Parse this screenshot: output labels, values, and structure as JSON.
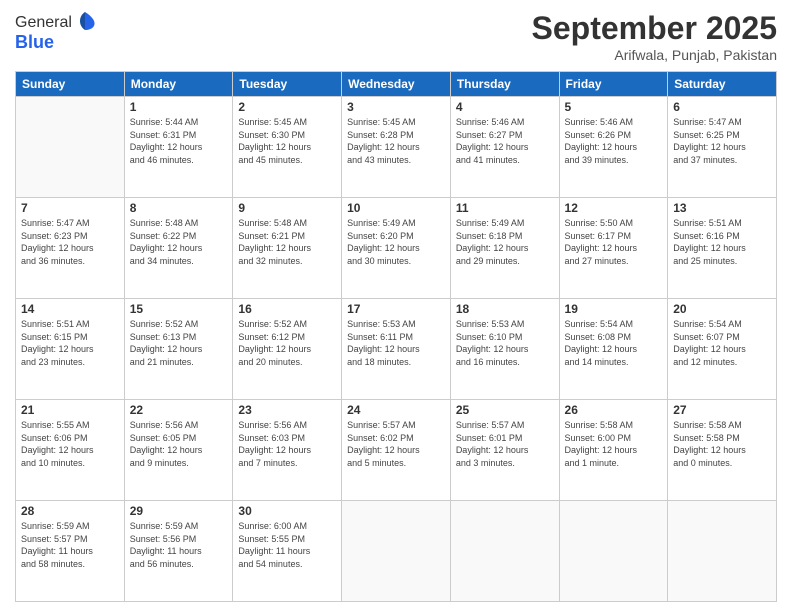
{
  "logo": {
    "line1": "General",
    "line2": "Blue"
  },
  "header": {
    "month": "September 2025",
    "location": "Arifwala, Punjab, Pakistan"
  },
  "days_of_week": [
    "Sunday",
    "Monday",
    "Tuesday",
    "Wednesday",
    "Thursday",
    "Friday",
    "Saturday"
  ],
  "weeks": [
    [
      {
        "day": "",
        "info": ""
      },
      {
        "day": "1",
        "info": "Sunrise: 5:44 AM\nSunset: 6:31 PM\nDaylight: 12 hours\nand 46 minutes."
      },
      {
        "day": "2",
        "info": "Sunrise: 5:45 AM\nSunset: 6:30 PM\nDaylight: 12 hours\nand 45 minutes."
      },
      {
        "day": "3",
        "info": "Sunrise: 5:45 AM\nSunset: 6:28 PM\nDaylight: 12 hours\nand 43 minutes."
      },
      {
        "day": "4",
        "info": "Sunrise: 5:46 AM\nSunset: 6:27 PM\nDaylight: 12 hours\nand 41 minutes."
      },
      {
        "day": "5",
        "info": "Sunrise: 5:46 AM\nSunset: 6:26 PM\nDaylight: 12 hours\nand 39 minutes."
      },
      {
        "day": "6",
        "info": "Sunrise: 5:47 AM\nSunset: 6:25 PM\nDaylight: 12 hours\nand 37 minutes."
      }
    ],
    [
      {
        "day": "7",
        "info": "Sunrise: 5:47 AM\nSunset: 6:23 PM\nDaylight: 12 hours\nand 36 minutes."
      },
      {
        "day": "8",
        "info": "Sunrise: 5:48 AM\nSunset: 6:22 PM\nDaylight: 12 hours\nand 34 minutes."
      },
      {
        "day": "9",
        "info": "Sunrise: 5:48 AM\nSunset: 6:21 PM\nDaylight: 12 hours\nand 32 minutes."
      },
      {
        "day": "10",
        "info": "Sunrise: 5:49 AM\nSunset: 6:20 PM\nDaylight: 12 hours\nand 30 minutes."
      },
      {
        "day": "11",
        "info": "Sunrise: 5:49 AM\nSunset: 6:18 PM\nDaylight: 12 hours\nand 29 minutes."
      },
      {
        "day": "12",
        "info": "Sunrise: 5:50 AM\nSunset: 6:17 PM\nDaylight: 12 hours\nand 27 minutes."
      },
      {
        "day": "13",
        "info": "Sunrise: 5:51 AM\nSunset: 6:16 PM\nDaylight: 12 hours\nand 25 minutes."
      }
    ],
    [
      {
        "day": "14",
        "info": "Sunrise: 5:51 AM\nSunset: 6:15 PM\nDaylight: 12 hours\nand 23 minutes."
      },
      {
        "day": "15",
        "info": "Sunrise: 5:52 AM\nSunset: 6:13 PM\nDaylight: 12 hours\nand 21 minutes."
      },
      {
        "day": "16",
        "info": "Sunrise: 5:52 AM\nSunset: 6:12 PM\nDaylight: 12 hours\nand 20 minutes."
      },
      {
        "day": "17",
        "info": "Sunrise: 5:53 AM\nSunset: 6:11 PM\nDaylight: 12 hours\nand 18 minutes."
      },
      {
        "day": "18",
        "info": "Sunrise: 5:53 AM\nSunset: 6:10 PM\nDaylight: 12 hours\nand 16 minutes."
      },
      {
        "day": "19",
        "info": "Sunrise: 5:54 AM\nSunset: 6:08 PM\nDaylight: 12 hours\nand 14 minutes."
      },
      {
        "day": "20",
        "info": "Sunrise: 5:54 AM\nSunset: 6:07 PM\nDaylight: 12 hours\nand 12 minutes."
      }
    ],
    [
      {
        "day": "21",
        "info": "Sunrise: 5:55 AM\nSunset: 6:06 PM\nDaylight: 12 hours\nand 10 minutes."
      },
      {
        "day": "22",
        "info": "Sunrise: 5:56 AM\nSunset: 6:05 PM\nDaylight: 12 hours\nand 9 minutes."
      },
      {
        "day": "23",
        "info": "Sunrise: 5:56 AM\nSunset: 6:03 PM\nDaylight: 12 hours\nand 7 minutes."
      },
      {
        "day": "24",
        "info": "Sunrise: 5:57 AM\nSunset: 6:02 PM\nDaylight: 12 hours\nand 5 minutes."
      },
      {
        "day": "25",
        "info": "Sunrise: 5:57 AM\nSunset: 6:01 PM\nDaylight: 12 hours\nand 3 minutes."
      },
      {
        "day": "26",
        "info": "Sunrise: 5:58 AM\nSunset: 6:00 PM\nDaylight: 12 hours\nand 1 minute."
      },
      {
        "day": "27",
        "info": "Sunrise: 5:58 AM\nSunset: 5:58 PM\nDaylight: 12 hours\nand 0 minutes."
      }
    ],
    [
      {
        "day": "28",
        "info": "Sunrise: 5:59 AM\nSunset: 5:57 PM\nDaylight: 11 hours\nand 58 minutes."
      },
      {
        "day": "29",
        "info": "Sunrise: 5:59 AM\nSunset: 5:56 PM\nDaylight: 11 hours\nand 56 minutes."
      },
      {
        "day": "30",
        "info": "Sunrise: 6:00 AM\nSunset: 5:55 PM\nDaylight: 11 hours\nand 54 minutes."
      },
      {
        "day": "",
        "info": ""
      },
      {
        "day": "",
        "info": ""
      },
      {
        "day": "",
        "info": ""
      },
      {
        "day": "",
        "info": ""
      }
    ]
  ]
}
